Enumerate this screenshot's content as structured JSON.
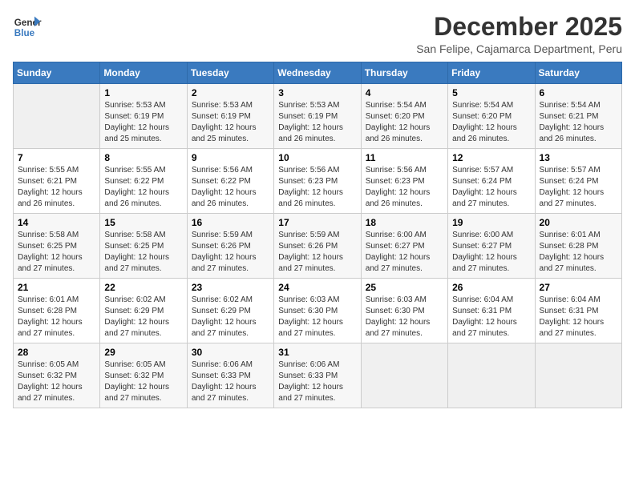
{
  "header": {
    "logo_line1": "General",
    "logo_line2": "Blue",
    "month": "December 2025",
    "location": "San Felipe, Cajamarca Department, Peru"
  },
  "days_of_week": [
    "Sunday",
    "Monday",
    "Tuesday",
    "Wednesday",
    "Thursday",
    "Friday",
    "Saturday"
  ],
  "weeks": [
    [
      {
        "num": "",
        "info": ""
      },
      {
        "num": "1",
        "info": "Sunrise: 5:53 AM\nSunset: 6:19 PM\nDaylight: 12 hours\nand 25 minutes."
      },
      {
        "num": "2",
        "info": "Sunrise: 5:53 AM\nSunset: 6:19 PM\nDaylight: 12 hours\nand 25 minutes."
      },
      {
        "num": "3",
        "info": "Sunrise: 5:53 AM\nSunset: 6:19 PM\nDaylight: 12 hours\nand 26 minutes."
      },
      {
        "num": "4",
        "info": "Sunrise: 5:54 AM\nSunset: 6:20 PM\nDaylight: 12 hours\nand 26 minutes."
      },
      {
        "num": "5",
        "info": "Sunrise: 5:54 AM\nSunset: 6:20 PM\nDaylight: 12 hours\nand 26 minutes."
      },
      {
        "num": "6",
        "info": "Sunrise: 5:54 AM\nSunset: 6:21 PM\nDaylight: 12 hours\nand 26 minutes."
      }
    ],
    [
      {
        "num": "7",
        "info": "Sunrise: 5:55 AM\nSunset: 6:21 PM\nDaylight: 12 hours\nand 26 minutes."
      },
      {
        "num": "8",
        "info": "Sunrise: 5:55 AM\nSunset: 6:22 PM\nDaylight: 12 hours\nand 26 minutes."
      },
      {
        "num": "9",
        "info": "Sunrise: 5:56 AM\nSunset: 6:22 PM\nDaylight: 12 hours\nand 26 minutes."
      },
      {
        "num": "10",
        "info": "Sunrise: 5:56 AM\nSunset: 6:23 PM\nDaylight: 12 hours\nand 26 minutes."
      },
      {
        "num": "11",
        "info": "Sunrise: 5:56 AM\nSunset: 6:23 PM\nDaylight: 12 hours\nand 26 minutes."
      },
      {
        "num": "12",
        "info": "Sunrise: 5:57 AM\nSunset: 6:24 PM\nDaylight: 12 hours\nand 27 minutes."
      },
      {
        "num": "13",
        "info": "Sunrise: 5:57 AM\nSunset: 6:24 PM\nDaylight: 12 hours\nand 27 minutes."
      }
    ],
    [
      {
        "num": "14",
        "info": "Sunrise: 5:58 AM\nSunset: 6:25 PM\nDaylight: 12 hours\nand 27 minutes."
      },
      {
        "num": "15",
        "info": "Sunrise: 5:58 AM\nSunset: 6:25 PM\nDaylight: 12 hours\nand 27 minutes."
      },
      {
        "num": "16",
        "info": "Sunrise: 5:59 AM\nSunset: 6:26 PM\nDaylight: 12 hours\nand 27 minutes."
      },
      {
        "num": "17",
        "info": "Sunrise: 5:59 AM\nSunset: 6:26 PM\nDaylight: 12 hours\nand 27 minutes."
      },
      {
        "num": "18",
        "info": "Sunrise: 6:00 AM\nSunset: 6:27 PM\nDaylight: 12 hours\nand 27 minutes."
      },
      {
        "num": "19",
        "info": "Sunrise: 6:00 AM\nSunset: 6:27 PM\nDaylight: 12 hours\nand 27 minutes."
      },
      {
        "num": "20",
        "info": "Sunrise: 6:01 AM\nSunset: 6:28 PM\nDaylight: 12 hours\nand 27 minutes."
      }
    ],
    [
      {
        "num": "21",
        "info": "Sunrise: 6:01 AM\nSunset: 6:28 PM\nDaylight: 12 hours\nand 27 minutes."
      },
      {
        "num": "22",
        "info": "Sunrise: 6:02 AM\nSunset: 6:29 PM\nDaylight: 12 hours\nand 27 minutes."
      },
      {
        "num": "23",
        "info": "Sunrise: 6:02 AM\nSunset: 6:29 PM\nDaylight: 12 hours\nand 27 minutes."
      },
      {
        "num": "24",
        "info": "Sunrise: 6:03 AM\nSunset: 6:30 PM\nDaylight: 12 hours\nand 27 minutes."
      },
      {
        "num": "25",
        "info": "Sunrise: 6:03 AM\nSunset: 6:30 PM\nDaylight: 12 hours\nand 27 minutes."
      },
      {
        "num": "26",
        "info": "Sunrise: 6:04 AM\nSunset: 6:31 PM\nDaylight: 12 hours\nand 27 minutes."
      },
      {
        "num": "27",
        "info": "Sunrise: 6:04 AM\nSunset: 6:31 PM\nDaylight: 12 hours\nand 27 minutes."
      }
    ],
    [
      {
        "num": "28",
        "info": "Sunrise: 6:05 AM\nSunset: 6:32 PM\nDaylight: 12 hours\nand 27 minutes."
      },
      {
        "num": "29",
        "info": "Sunrise: 6:05 AM\nSunset: 6:32 PM\nDaylight: 12 hours\nand 27 minutes."
      },
      {
        "num": "30",
        "info": "Sunrise: 6:06 AM\nSunset: 6:33 PM\nDaylight: 12 hours\nand 27 minutes."
      },
      {
        "num": "31",
        "info": "Sunrise: 6:06 AM\nSunset: 6:33 PM\nDaylight: 12 hours\nand 27 minutes."
      },
      {
        "num": "",
        "info": ""
      },
      {
        "num": "",
        "info": ""
      },
      {
        "num": "",
        "info": ""
      }
    ]
  ]
}
